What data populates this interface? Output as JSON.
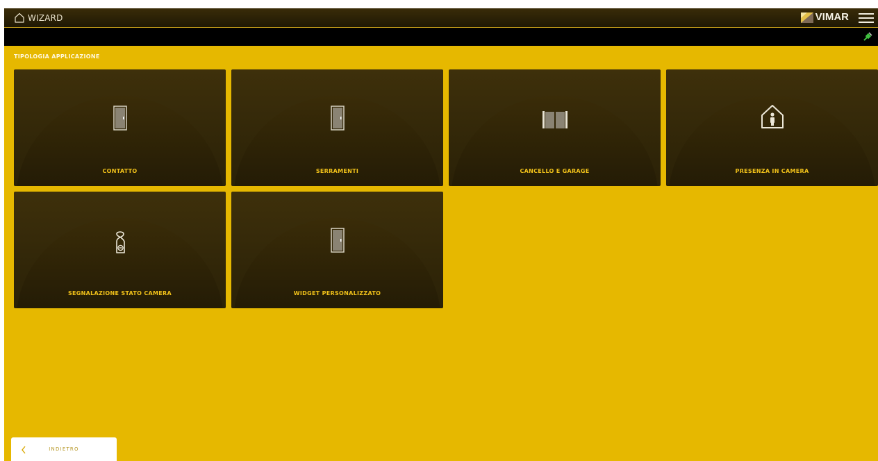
{
  "header": {
    "title": "WIZARD",
    "brand": "VIMAR",
    "home_icon": "home-icon",
    "menu_icon": "hamburger-menu-icon"
  },
  "status": {
    "connection_icon": "connection-plug-icon"
  },
  "section": {
    "title": "TIPOLOGIA APPLICAZIONE"
  },
  "tiles": [
    {
      "label": "CONTATTO",
      "icon": "door-icon"
    },
    {
      "label": "SERRAMENTI",
      "icon": "door-icon"
    },
    {
      "label": "CANCELLO E GARAGE",
      "icon": "gate-icon"
    },
    {
      "label": "PRESENZA IN CAMERA",
      "icon": "person-in-house-icon"
    },
    {
      "label": "SEGNALAZIONE STATO CAMERA",
      "icon": "door-hanger-icon"
    },
    {
      "label": "WIDGET PERSONALIZZATO",
      "icon": "door-icon"
    }
  ],
  "footer": {
    "back_label": "INDIETRO",
    "back_icon": "chevron-left-icon"
  },
  "colors": {
    "background": "#e6b800",
    "tile": "#2e2408",
    "tile_label": "#f2c21a",
    "topbar": "#2a2106"
  }
}
